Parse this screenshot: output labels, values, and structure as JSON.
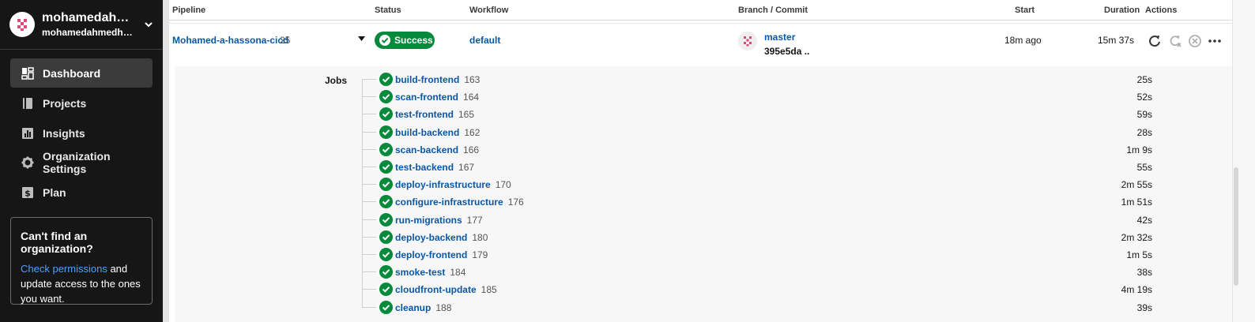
{
  "sidebar": {
    "org_name": "mohamedahm...",
    "org_sub": "mohamedahmedhass...",
    "nav": [
      {
        "label": "Dashboard",
        "icon": "dashboard-icon",
        "active": true
      },
      {
        "label": "Projects",
        "icon": "projects-icon",
        "active": false
      },
      {
        "label": "Insights",
        "icon": "insights-icon",
        "active": false
      },
      {
        "label": "Organization Settings",
        "icon": "gear-icon",
        "active": false
      },
      {
        "label": "Plan",
        "icon": "dollar-icon",
        "active": false
      }
    ],
    "org_box": {
      "title": "Can't find an organization?",
      "link": "Check permissions",
      "text_after_link": " and update access to the ones you want."
    }
  },
  "table": {
    "headers": {
      "pipeline": "Pipeline",
      "status": "Status",
      "workflow": "Workflow",
      "branch_commit": "Branch / Commit",
      "start": "Start",
      "duration": "Duration",
      "actions": "Actions"
    }
  },
  "pipeline": {
    "name": "Mohamed-a-hassona-cicd",
    "number": "25",
    "status": "Success",
    "workflow": "default",
    "branch": "master",
    "commit": "395e5da ..",
    "start": "18m ago",
    "duration": "15m 37s"
  },
  "jobs_label": "Jobs",
  "jobs": [
    {
      "name": "build-frontend",
      "num": "163",
      "duration": "25s"
    },
    {
      "name": "scan-frontend",
      "num": "164",
      "duration": "52s"
    },
    {
      "name": "test-frontend",
      "num": "165",
      "duration": "59s"
    },
    {
      "name": "build-backend",
      "num": "162",
      "duration": "28s"
    },
    {
      "name": "scan-backend",
      "num": "166",
      "duration": "1m 9s"
    },
    {
      "name": "test-backend",
      "num": "167",
      "duration": "55s"
    },
    {
      "name": "deploy-infrastructure",
      "num": "170",
      "duration": "2m 55s"
    },
    {
      "name": "configure-infrastructure",
      "num": "176",
      "duration": "1m 51s"
    },
    {
      "name": "run-migrations",
      "num": "177",
      "duration": "42s"
    },
    {
      "name": "deploy-backend",
      "num": "180",
      "duration": "2m 32s"
    },
    {
      "name": "deploy-frontend",
      "num": "179",
      "duration": "1m 5s"
    },
    {
      "name": "smoke-test",
      "num": "184",
      "duration": "38s"
    },
    {
      "name": "cloudfront-update",
      "num": "185",
      "duration": "4m 19s"
    },
    {
      "name": "cleanup",
      "num": "188",
      "duration": "39s"
    }
  ],
  "colors": {
    "success": "#048a3a",
    "link": "#0a57a7",
    "sidebar_bg": "#161616"
  }
}
